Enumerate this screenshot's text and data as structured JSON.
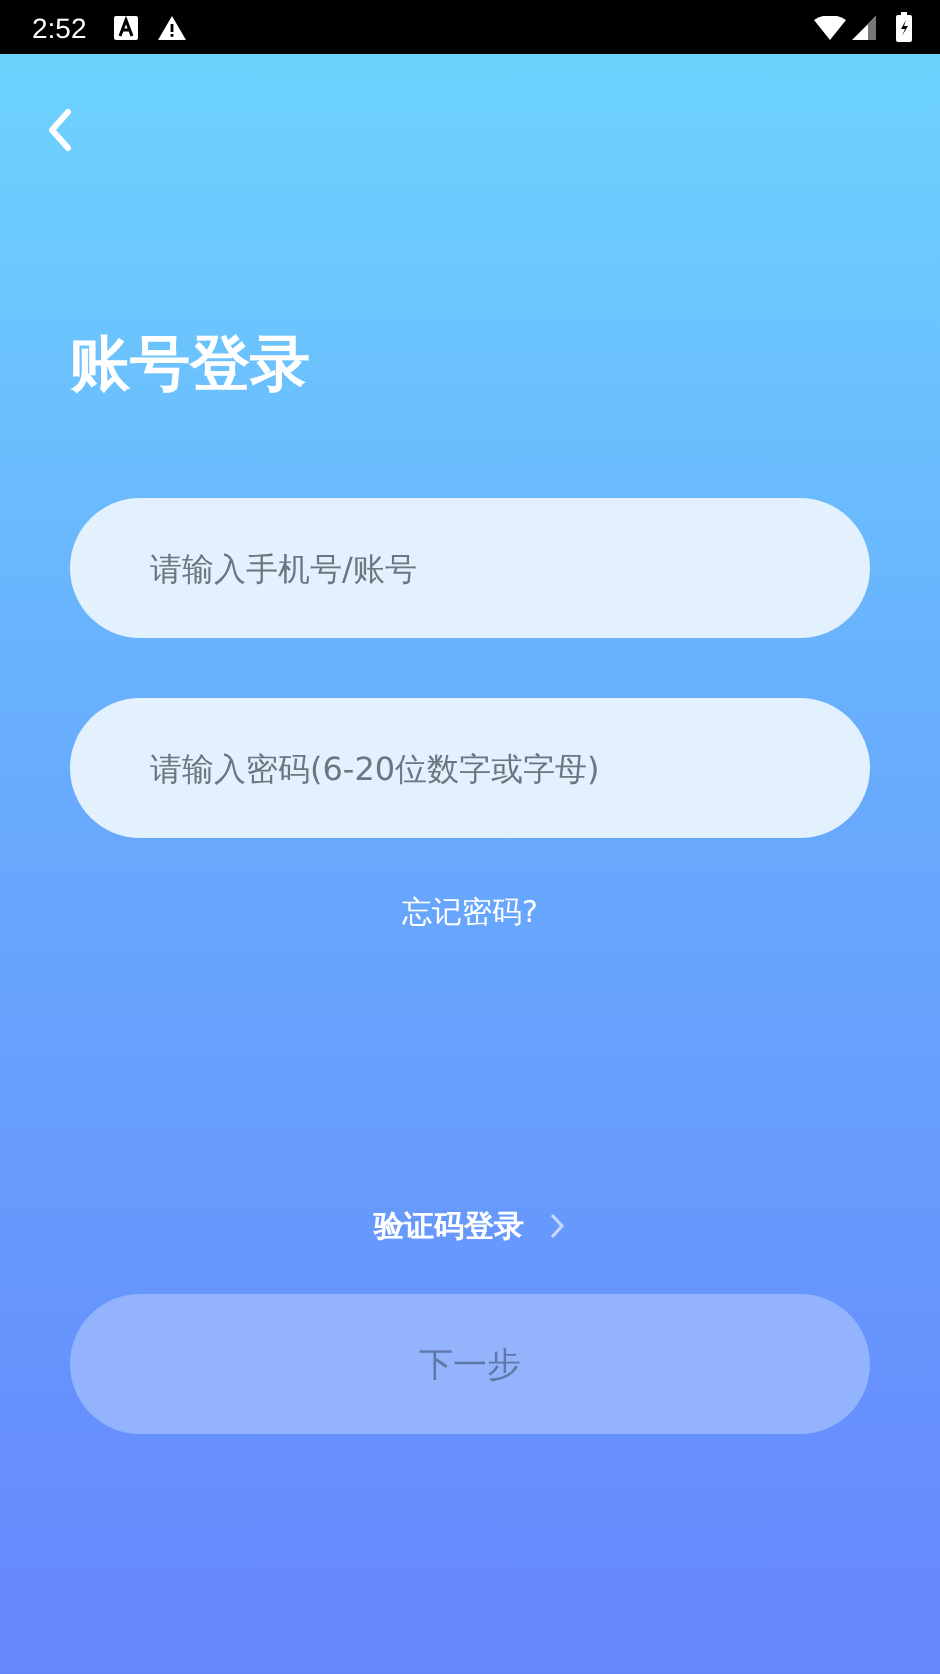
{
  "status_bar": {
    "time": "2:52"
  },
  "title": "账号登录",
  "fields": [
    {
      "placeholder": "请输入手机号/账号"
    },
    {
      "placeholder": "请输入密码(6-20位数字或字母)"
    }
  ],
  "forgot_link": "忘记密码?",
  "sms_login_link": "验证码登录",
  "next_button": {
    "label": "下一步",
    "disabled": true
  }
}
